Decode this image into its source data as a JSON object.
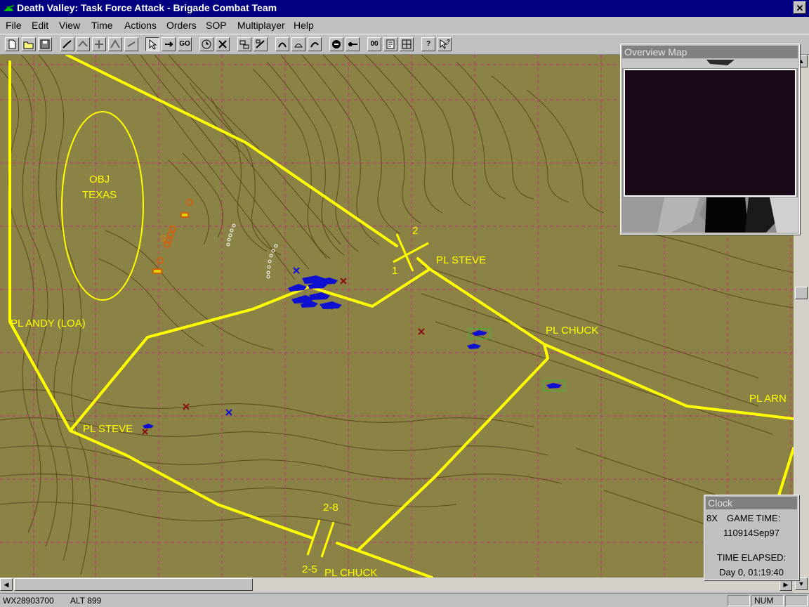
{
  "window": {
    "title": "Death Valley:  Task Force Attack - Brigade Combat Team",
    "close_label": "✕"
  },
  "menu": [
    "File",
    "Edit",
    "View",
    "Time",
    "Actions",
    "Orders",
    "SOP",
    "Multiplayer",
    "Help"
  ],
  "toolbar": {
    "go_label": "GO",
    "pause_label": "00",
    "help_label": "?"
  },
  "map": {
    "labels": {
      "obj_line1": "OBJ",
      "obj_line2": "TEXAS",
      "pl_andy": "PL ANDY (LOA)",
      "pl_steve_east": "PL STEVE",
      "pl_steve_west": "PL STEVE",
      "pl_chuck_north": "PL CHUCK",
      "pl_chuck_south": "PL CHUCK",
      "pl_arn": "PL ARN",
      "unit_1": "1",
      "unit_2": "2",
      "unit_28": "2-8",
      "unit_25": "2-5"
    },
    "colors": {
      "terrain": "#8b8246",
      "contour": "#5a4a1a",
      "grid": "#c0307a",
      "phase_line": "#ffff00",
      "friendly": "#1010d0"
    }
  },
  "overview": {
    "title": "Overview Map"
  },
  "clock": {
    "title": "Clock",
    "speed": "8X",
    "game_time_label": "GAME TIME:",
    "game_time_value": "110914Sep97",
    "elapsed_label": "TIME ELAPSED:",
    "elapsed_value": "Day 0, 01:19:40"
  },
  "status": {
    "coord": "WX28903700",
    "alt": "ALT  899",
    "num": "NUM"
  }
}
